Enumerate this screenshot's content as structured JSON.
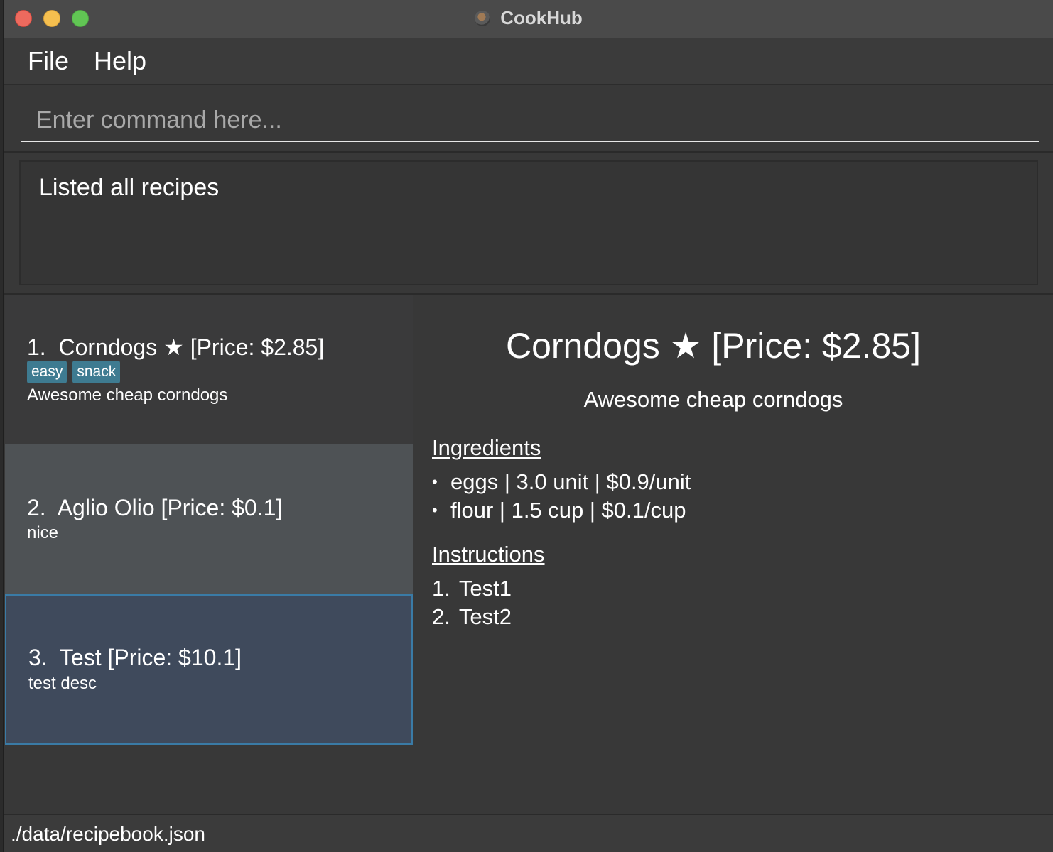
{
  "window": {
    "title": "CookHub",
    "icon": "cookhub-app-icon"
  },
  "menu": {
    "items": [
      {
        "label": "File"
      },
      {
        "label": "Help"
      }
    ]
  },
  "command": {
    "value": "",
    "placeholder": "Enter command here..."
  },
  "result": {
    "message": "Listed all recipes"
  },
  "recipes": [
    {
      "index": "1.",
      "title": "Corndogs ★ [Price: $2.85]",
      "tags": [
        "easy",
        "snack"
      ],
      "description": "Awesome cheap corndogs"
    },
    {
      "index": "2.",
      "title": "Aglio Olio [Price: $0.1]",
      "tags": [],
      "description": "nice"
    },
    {
      "index": "3.",
      "title": "Test [Price: $10.1]",
      "tags": [],
      "description": "test desc",
      "selected": true
    }
  ],
  "detail": {
    "title": "Corndogs ★ [Price: $2.85]",
    "description": "Awesome cheap corndogs",
    "ingredients_heading": "Ingredients",
    "ingredients": [
      "eggs | 3.0 unit | $0.9/unit",
      "flour | 1.5 cup | $0.1/cup"
    ],
    "instructions_heading": "Instructions",
    "instructions": [
      {
        "num": "1.",
        "text": "Test1"
      },
      {
        "num": "2.",
        "text": "Test2"
      }
    ]
  },
  "status": {
    "file_path": "./data/recipebook.json"
  },
  "colors": {
    "background": "#383838",
    "selected_card": "#3f4a5c",
    "selected_border": "#3a7ba6",
    "tag": "#3e7b91",
    "hover_card": "#4e5255"
  }
}
